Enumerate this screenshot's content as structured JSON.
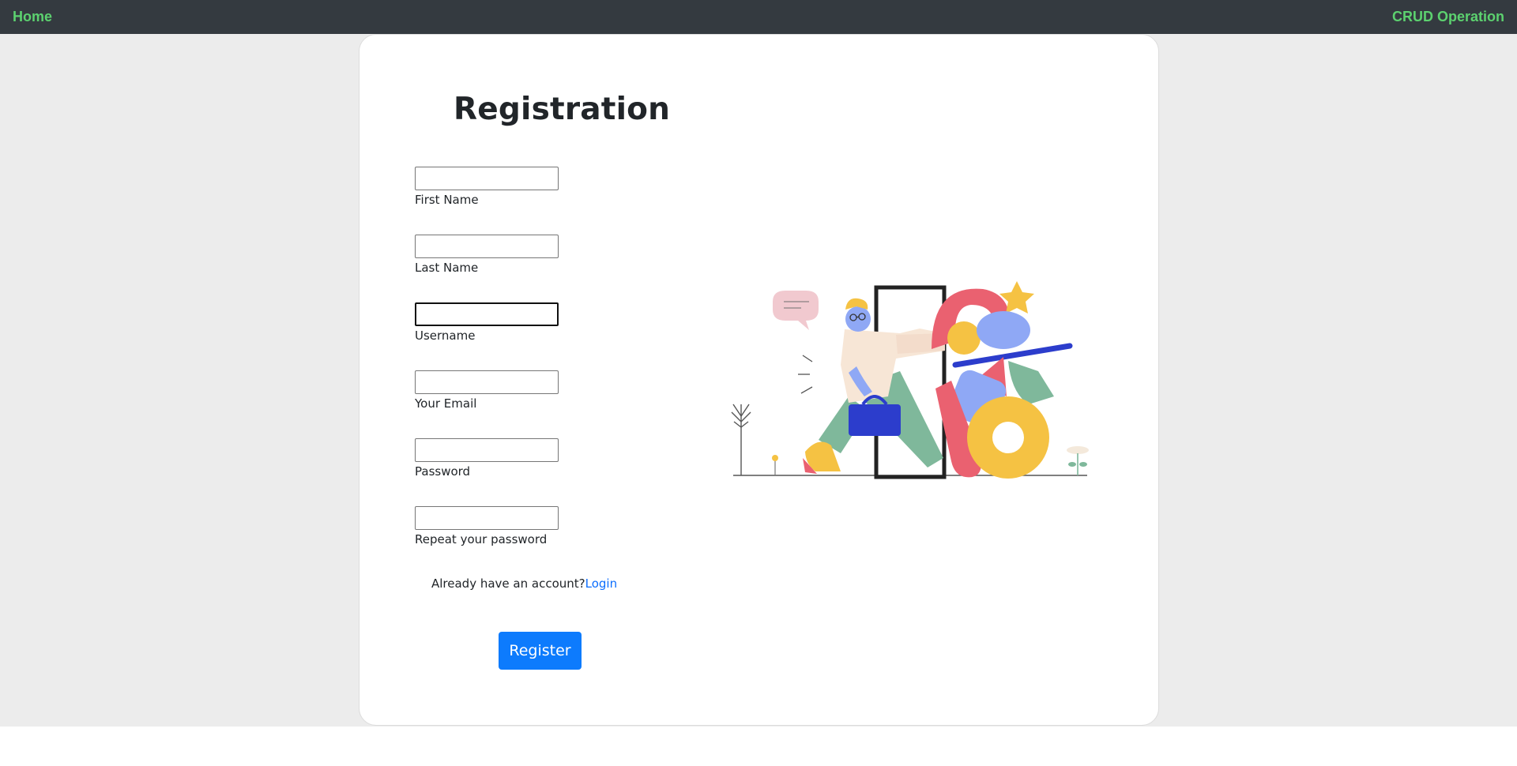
{
  "navbar": {
    "home_label": "Home",
    "brand_label": "CRUD Operation",
    "link_color": "#5cd16f",
    "background": "#343a40"
  },
  "form": {
    "title": "Registration",
    "fields": [
      {
        "label": "First Name",
        "value": ""
      },
      {
        "label": "Last Name",
        "value": ""
      },
      {
        "label": "Username",
        "value": "",
        "focused": true
      },
      {
        "label": "Your Email",
        "value": ""
      },
      {
        "label": "Password",
        "value": ""
      },
      {
        "label": "Repeat your password",
        "value": ""
      }
    ],
    "login_prompt": "Already have an account?",
    "login_link": "Login",
    "submit_label": "Register",
    "accent_color": "#0d7bfd"
  },
  "illustration": {
    "icon": "person-walking-through-door-illustration"
  }
}
